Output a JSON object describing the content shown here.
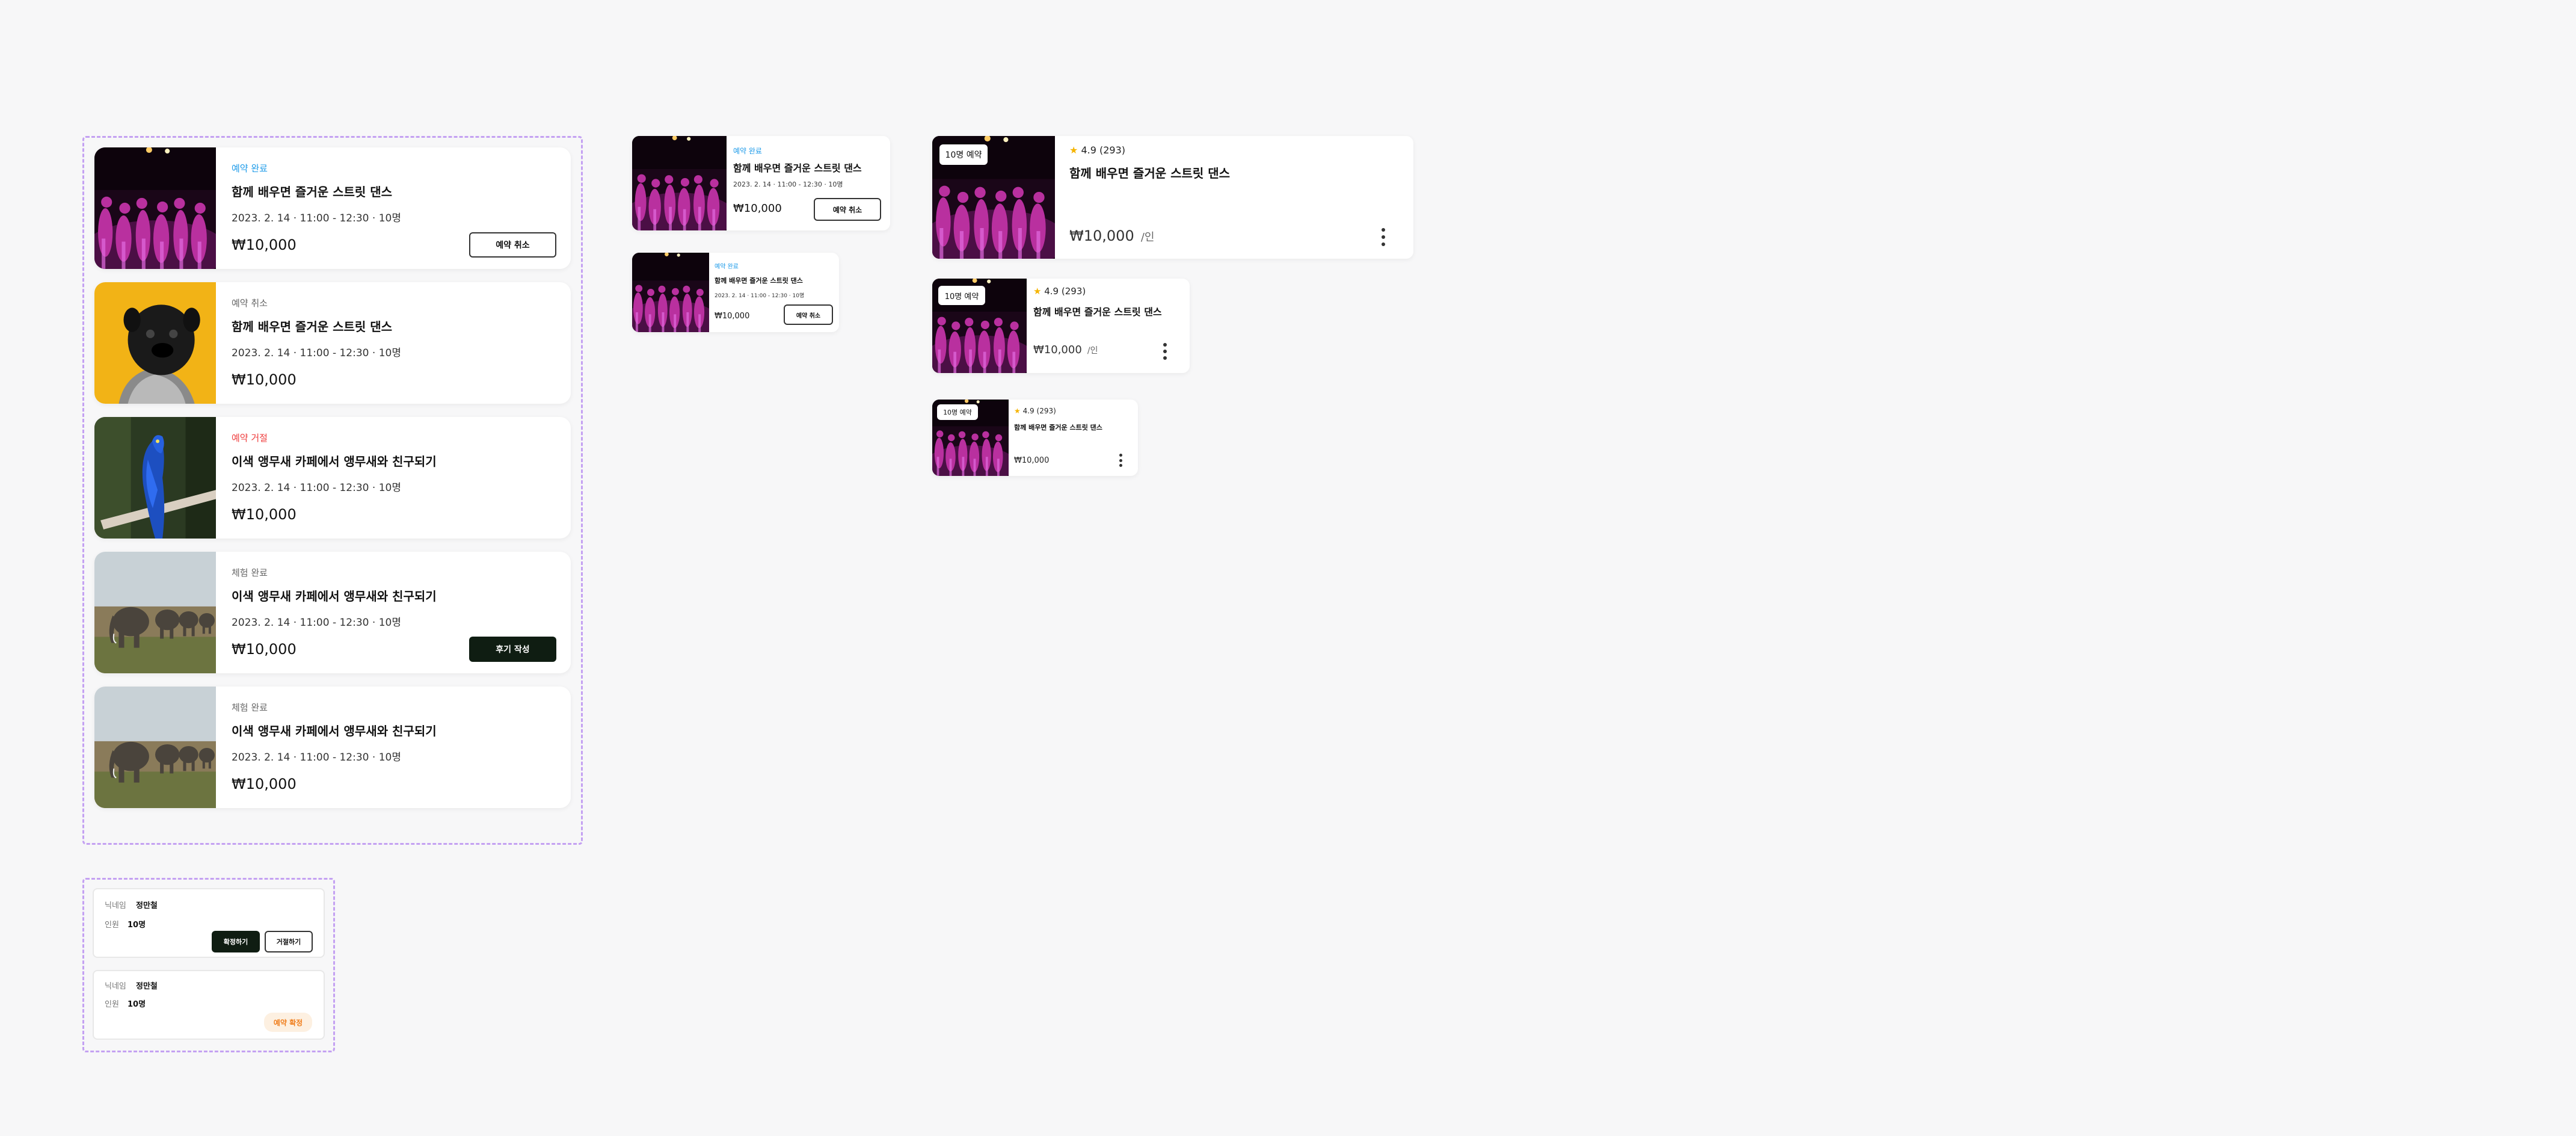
{
  "reservation_list": [
    {
      "status": "예약 완료",
      "status_color": "#1e9be9",
      "title": "함께 배우면 즐거운 스트릿 댄스",
      "date": "2023. 2. 14",
      "time": "11:00 - 12:30",
      "people": "10명",
      "price": "₩10,000",
      "button": "예약 취소",
      "image": "dance-image"
    },
    {
      "status": "예약 취소",
      "status_color": "#666666",
      "title": "함께 배우면 즐거운 스트릿 댄스",
      "date": "2023. 2. 14",
      "time": "11:00 - 12:30",
      "people": "10명",
      "price": "₩10,000",
      "image": "pug-image"
    },
    {
      "status": "예약 거절",
      "status_color": "#ef3d3d",
      "title": "이색 앵무새 카페에서 앵무새와 친구되기",
      "date": "2023. 2. 14",
      "time": "11:00 - 12:30",
      "people": "10명",
      "price": "₩10,000",
      "image": "parrot-image"
    },
    {
      "status": "체험 완료",
      "status_color": "#666666",
      "title": "이색 앵무새 카페에서 앵무새와 친구되기",
      "date": "2023. 2. 14",
      "time": "11:00 - 12:30",
      "people": "10명",
      "price": "₩10,000",
      "button": "후기 작성",
      "image": "elephant-image"
    },
    {
      "status": "체험 완료",
      "status_color": "#666666",
      "title": "이색 앵무새 카페에서 앵무새와 친구되기",
      "date": "2023. 2. 14",
      "time": "11:00 - 12:30",
      "people": "10명",
      "price": "₩10,000",
      "image": "elephant-image"
    }
  ],
  "medium_card": {
    "status": "예약 완료",
    "title": "함께 배우면 즐거운 스트릿 댄스",
    "meta": "2023. 2. 14 · 11:00 - 12:30 · 10명",
    "price": "₩10,000",
    "button": "예약 취소"
  },
  "small_card": {
    "status": "예약 완료",
    "title": "함께 배우면 즐거운 스트릿 댄스",
    "meta": "2023. 2. 14 · 11:00 - 12:30 · 10명",
    "price": "₩10,000",
    "button": "예약 취소"
  },
  "product_cards": {
    "badge": "10명 예약",
    "rating": "4.9",
    "reviews": "(293)",
    "title": "함께 배우면 즐거운 스트릿 댄스",
    "price": "₩10,000",
    "per": "/인"
  },
  "participants": [
    {
      "nickname_label": "닉네임",
      "nickname": "정만철",
      "people_label": "인원",
      "people": "10명",
      "confirm": "확정하기",
      "reject": "거절하기"
    },
    {
      "nickname_label": "닉네임",
      "nickname": "정만철",
      "people_label": "인원",
      "people": "10명",
      "status": "예약 확정"
    }
  ],
  "colors": {
    "accent_blue": "#1e9be9",
    "reject_red": "#ef3d3d",
    "dark_button": "#0f1d12",
    "dash_border": "#c4a1f2",
    "star": "#f5b400",
    "confirmed_orange": "#f07f1e"
  }
}
